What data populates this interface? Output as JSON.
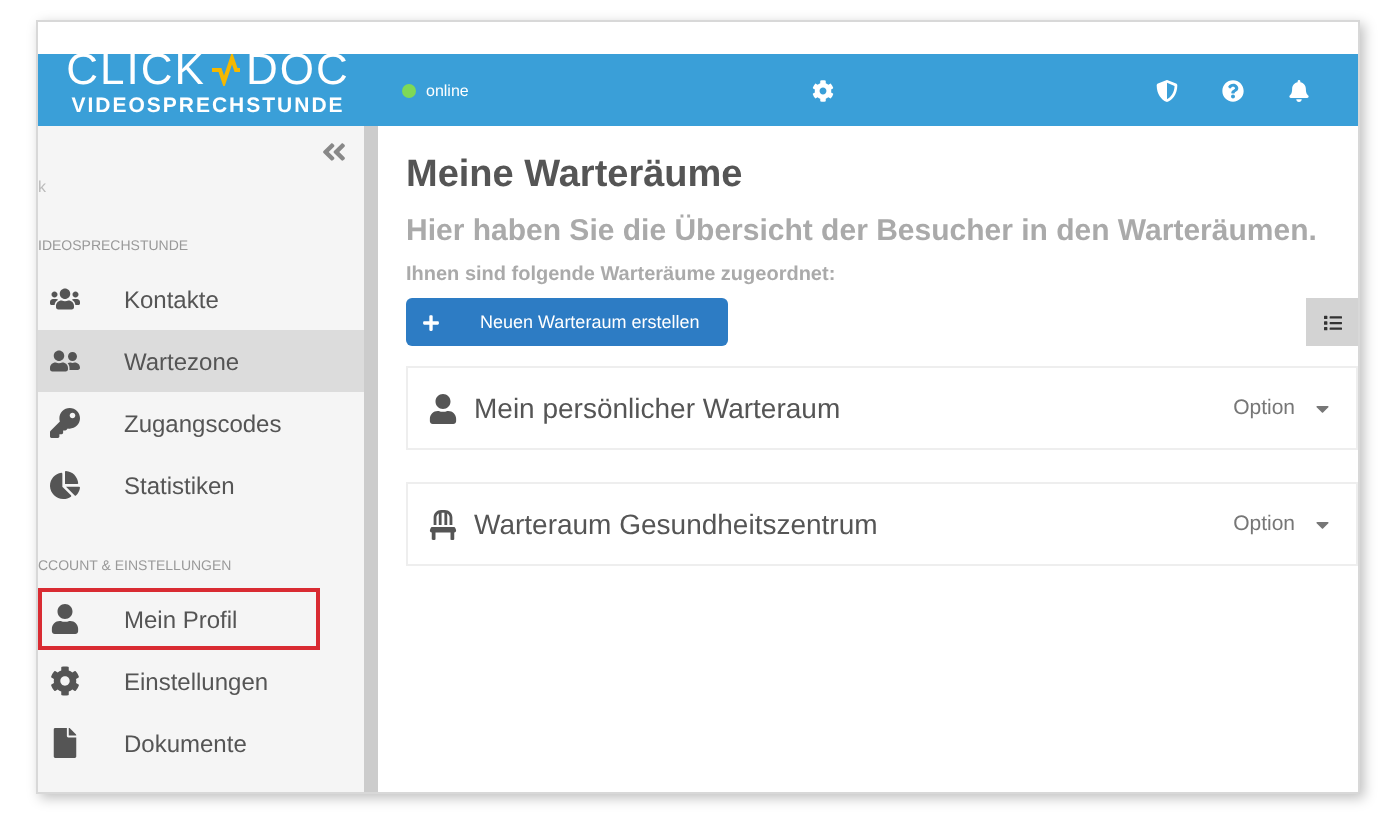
{
  "header": {
    "logo_top": "CLICK",
    "logo_top_2": "DOC",
    "logo_sub": "VIDEOSPRECHSTUNDE",
    "status": {
      "label": "online",
      "online": true
    }
  },
  "sidebar": {
    "search_fragment": "k",
    "items": [
      {
        "kind": "header",
        "label": "IDEOSPRECHSTUNDE"
      },
      {
        "kind": "item",
        "label": "Kontakte",
        "selected": false,
        "highlighted": false
      },
      {
        "kind": "item",
        "label": "Wartezone",
        "selected": true,
        "highlighted": false
      },
      {
        "kind": "item",
        "label": "Zugangscodes",
        "selected": false,
        "highlighted": false
      },
      {
        "kind": "item",
        "label": "Statistiken",
        "selected": false,
        "highlighted": false
      },
      {
        "kind": "header",
        "label": "CCOUNT & EINSTELLUNGEN"
      },
      {
        "kind": "item",
        "label": "Mein Profil",
        "selected": false,
        "highlighted": true
      },
      {
        "kind": "item",
        "label": "Einstellungen",
        "selected": false,
        "highlighted": false
      },
      {
        "kind": "item",
        "label": "Dokumente",
        "selected": false,
        "highlighted": false
      }
    ]
  },
  "main": {
    "title": "Meine Warteräume",
    "subtitle": "Hier haben Sie die Übersicht der Besucher in den Warteräumen.",
    "intro": "Ihnen sind folgende Warteräume zugeordnet:",
    "create_button": "Neuen Warteraum erstellen",
    "rooms": [
      {
        "name": "Mein persönlicher Warteraum",
        "option": "Option"
      },
      {
        "name": "Warteraum Gesundheitszentrum",
        "option": "Option"
      }
    ]
  }
}
